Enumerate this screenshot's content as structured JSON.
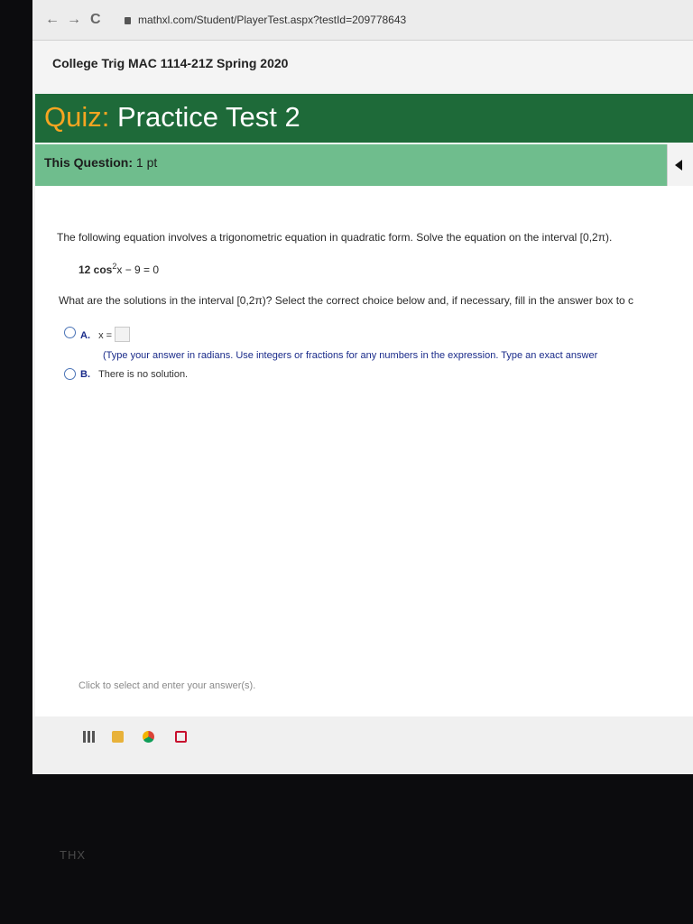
{
  "browser": {
    "back_icon": "←",
    "forward_icon": "→",
    "reload_icon": "C",
    "url": "mathxl.com/Student/PlayerTest.aspx?testId=209778643"
  },
  "course": {
    "title": "College Trig MAC 1114-21Z Spring 2020"
  },
  "quiz": {
    "prefix": "Quiz:",
    "title": "Practice Test 2"
  },
  "question_bar": {
    "label": "This Question:",
    "points": "1 pt"
  },
  "question": {
    "prompt": "The following equation involves a trigonometric equation in quadratic form. Solve the equation on the interval [0,2π).",
    "equation": {
      "coef": "12 cos",
      "sup": "2",
      "rest": "x − 9 = 0"
    },
    "instruction": "What are the solutions in the interval [0,2π)? Select the correct choice below and, if necessary, fill in the answer box to c",
    "choices": [
      {
        "letter": "A.",
        "text": "x =",
        "note": "(Type your answer in radians. Use integers or fractions for any numbers in the expression. Type an exact answer"
      },
      {
        "letter": "B.",
        "text": "There is no solution."
      }
    ],
    "hint": "Click to select and enter your answer(s)."
  },
  "bezel": {
    "logo": "THX"
  },
  "colors": {
    "quiz_bar": "#1e6a39",
    "question_bar": "#6fbd8d",
    "quiz_prefix": "#f7a521"
  }
}
